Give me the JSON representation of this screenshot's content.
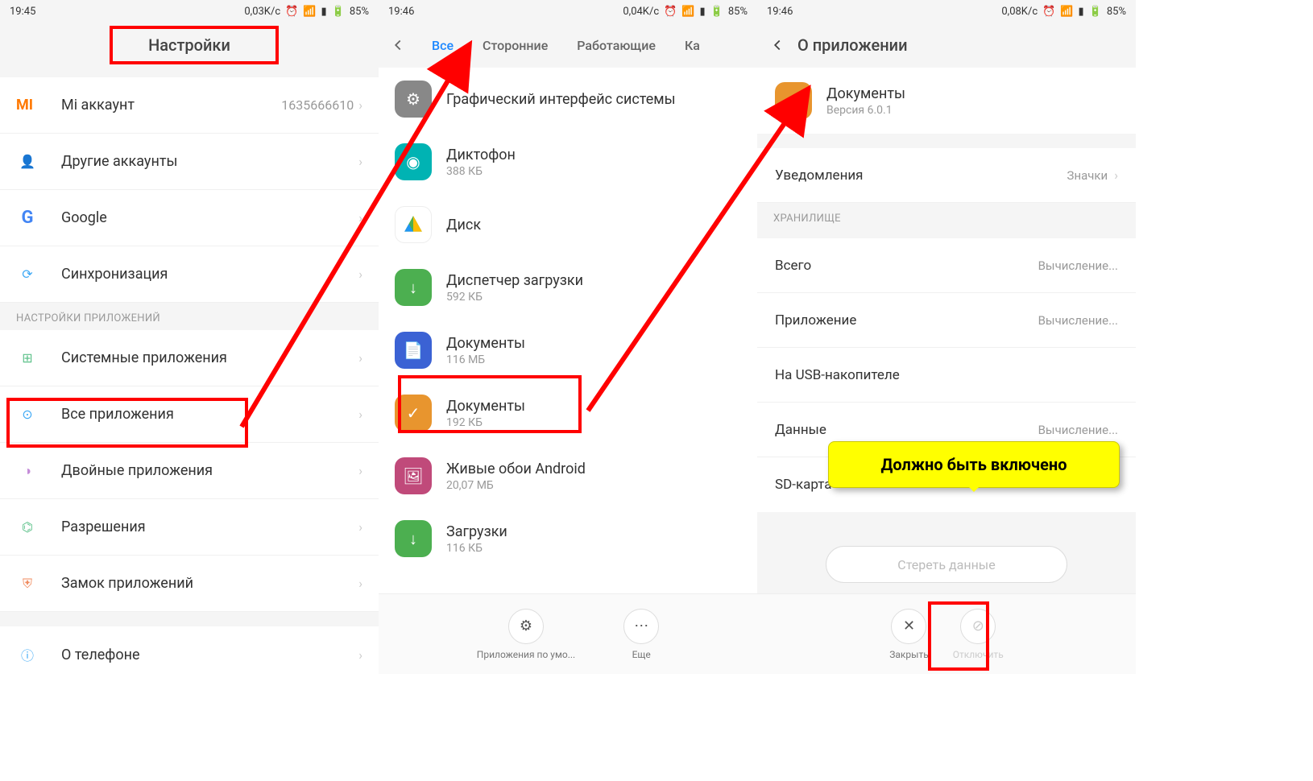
{
  "screen1": {
    "statusbar": {
      "time": "19:45",
      "speed": "0,03K/c",
      "battery": "85%"
    },
    "header": {
      "title": "Настройки"
    },
    "rows": [
      {
        "label": "Mi аккаунт",
        "value": "1635666610"
      },
      {
        "label": "Другие аккаунты"
      },
      {
        "label": "Google"
      },
      {
        "label": "Синхронизация"
      }
    ],
    "section": "НАСТРОЙКИ ПРИЛОЖЕНИЙ",
    "rows2": [
      {
        "label": "Системные приложения"
      },
      {
        "label": "Все приложения"
      },
      {
        "label": "Двойные приложения"
      },
      {
        "label": "Разрешения"
      },
      {
        "label": "Замок приложений"
      },
      {
        "label": "О телефоне"
      }
    ]
  },
  "screen2": {
    "statusbar": {
      "time": "19:46",
      "speed": "0,04K/c",
      "battery": "85%"
    },
    "tabs": {
      "all": "Все",
      "third": "Сторонние",
      "running": "Работающие",
      "partial": "Ка"
    },
    "apps": [
      {
        "name": "Графический интерфейс системы",
        "size": "",
        "color": "#888"
      },
      {
        "name": "Диктофон",
        "size": "388 КБ",
        "color": "#00b3b3"
      },
      {
        "name": "Диск",
        "size": "",
        "color": "#ffffff"
      },
      {
        "name": "Диспетчер загрузки",
        "size": "592 КБ",
        "color": "#4caf50"
      },
      {
        "name": "Документы",
        "size": "116 МБ",
        "color": "#3b62d4"
      },
      {
        "name": "Документы",
        "size": "192 КБ",
        "color": "#e8952e"
      },
      {
        "name": "Живые обои Android",
        "size": "20,07 МБ",
        "color": "#c04a7a"
      },
      {
        "name": "Загрузки",
        "size": "116 КБ",
        "color": "#4caf50"
      }
    ],
    "actions": {
      "defaults": "Приложения по умо...",
      "more": "Еще"
    }
  },
  "screen3": {
    "statusbar": {
      "time": "19:46",
      "speed": "0,08K/c",
      "battery": "85%"
    },
    "header": {
      "title": "О приложении"
    },
    "app": {
      "name": "Документы",
      "version": "Версия 6.0.1",
      "color": "#e8952e"
    },
    "notif": {
      "label": "Уведомления",
      "value": "Значки"
    },
    "storage_section": "ХРАНИЛИЩЕ",
    "storage": [
      {
        "k": "Всего",
        "v": "Вычисление..."
      },
      {
        "k": "Приложение",
        "v": "Вычисление..."
      },
      {
        "k": "На USB-накопителе",
        "v": ""
      },
      {
        "k": "Данные",
        "v": "Вычисление..."
      },
      {
        "k": "SD-карта",
        "v": ""
      }
    ],
    "clear_btn": "Стереть данные",
    "actions": {
      "close": "Закрыть",
      "disable": "Отключить"
    }
  },
  "callout": {
    "text": "Должно быть включено"
  }
}
